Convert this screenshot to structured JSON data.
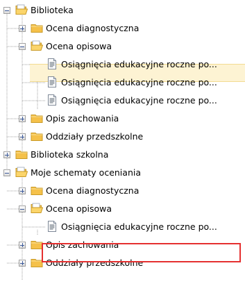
{
  "tree": [
    {
      "label": "Biblioteka",
      "icon": "open-folder-icon",
      "toggle": "minus",
      "level": 0
    },
    {
      "label": "Ocena diagnostyczna",
      "icon": "folder-icon",
      "toggle": "plus",
      "level": 1
    },
    {
      "label": "Ocena opisowa",
      "icon": "open-folder-icon",
      "toggle": "minus",
      "level": 1
    },
    {
      "label": "Osiągnięcia edukacyjne roczne po...",
      "icon": "document-icon",
      "toggle": "none",
      "level": 2,
      "selected": true
    },
    {
      "label": "Osiągnięcia edukacyjne roczne po...",
      "icon": "document-icon",
      "toggle": "none",
      "level": 2
    },
    {
      "label": "Osiągnięcia edukacyjne roczne po...",
      "icon": "document-icon",
      "toggle": "none",
      "level": 2
    },
    {
      "label": "Opis zachowania",
      "icon": "folder-icon",
      "toggle": "plus",
      "level": 1
    },
    {
      "label": "Oddziały przedszkolne",
      "icon": "folder-icon",
      "toggle": "plus",
      "level": 1
    },
    {
      "label": "Biblioteka szkolna",
      "icon": "folder-icon",
      "toggle": "plus",
      "level": 0
    },
    {
      "label": "Moje schematy oceniania",
      "icon": "open-folder-icon",
      "toggle": "minus",
      "level": 0
    },
    {
      "label": "Ocena diagnostyczna",
      "icon": "folder-icon",
      "toggle": "plus",
      "level": 1
    },
    {
      "label": "Ocena opisowa",
      "icon": "open-folder-icon",
      "toggle": "minus",
      "level": 1
    },
    {
      "label": "Osiągnięcia edukacyjne roczne po...",
      "icon": "document-icon",
      "toggle": "none",
      "level": 2,
      "highlighted": true
    },
    {
      "label": "Opis zachowania",
      "icon": "folder-icon",
      "toggle": "plus",
      "level": 1
    },
    {
      "label": "Oddziały przedszkolne",
      "icon": "folder-icon",
      "toggle": "plus",
      "level": 1
    }
  ],
  "colors": {
    "selection_background": "#fdf3d3",
    "highlight_border": "#e53030",
    "folder": "#f7c948",
    "tree_line": "#a0a0a0"
  }
}
